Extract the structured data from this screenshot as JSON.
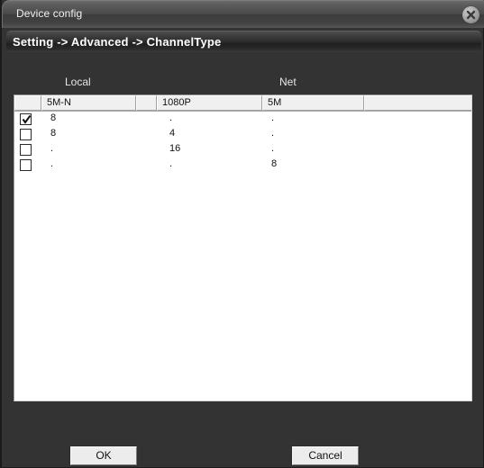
{
  "window": {
    "title": "Device config",
    "close_icon": "close-icon"
  },
  "breadcrumb": {
    "text": "Setting -> Advanced -> ChannelType"
  },
  "groups": {
    "local_label": "Local",
    "net_label": "Net"
  },
  "table": {
    "headers": [
      "",
      "5M-N",
      "",
      "1080P",
      "5M",
      ""
    ],
    "rows": [
      {
        "checked": true,
        "local": "8",
        "p1080": ".",
        "net5m": "."
      },
      {
        "checked": false,
        "local": "8",
        "p1080": "4",
        "net5m": "."
      },
      {
        "checked": false,
        "local": ".",
        "p1080": "16",
        "net5m": "."
      },
      {
        "checked": false,
        "local": ".",
        "p1080": ".",
        "net5m": "8"
      }
    ]
  },
  "footer": {
    "ok_label": "OK",
    "cancel_label": "Cancel"
  },
  "colors": {
    "window_bg": "#333333",
    "panel_bg": "#ffffff",
    "header_cell_bg": "#f0f0f0",
    "text_light": "#e6e6e6",
    "text_dark": "#111111"
  }
}
